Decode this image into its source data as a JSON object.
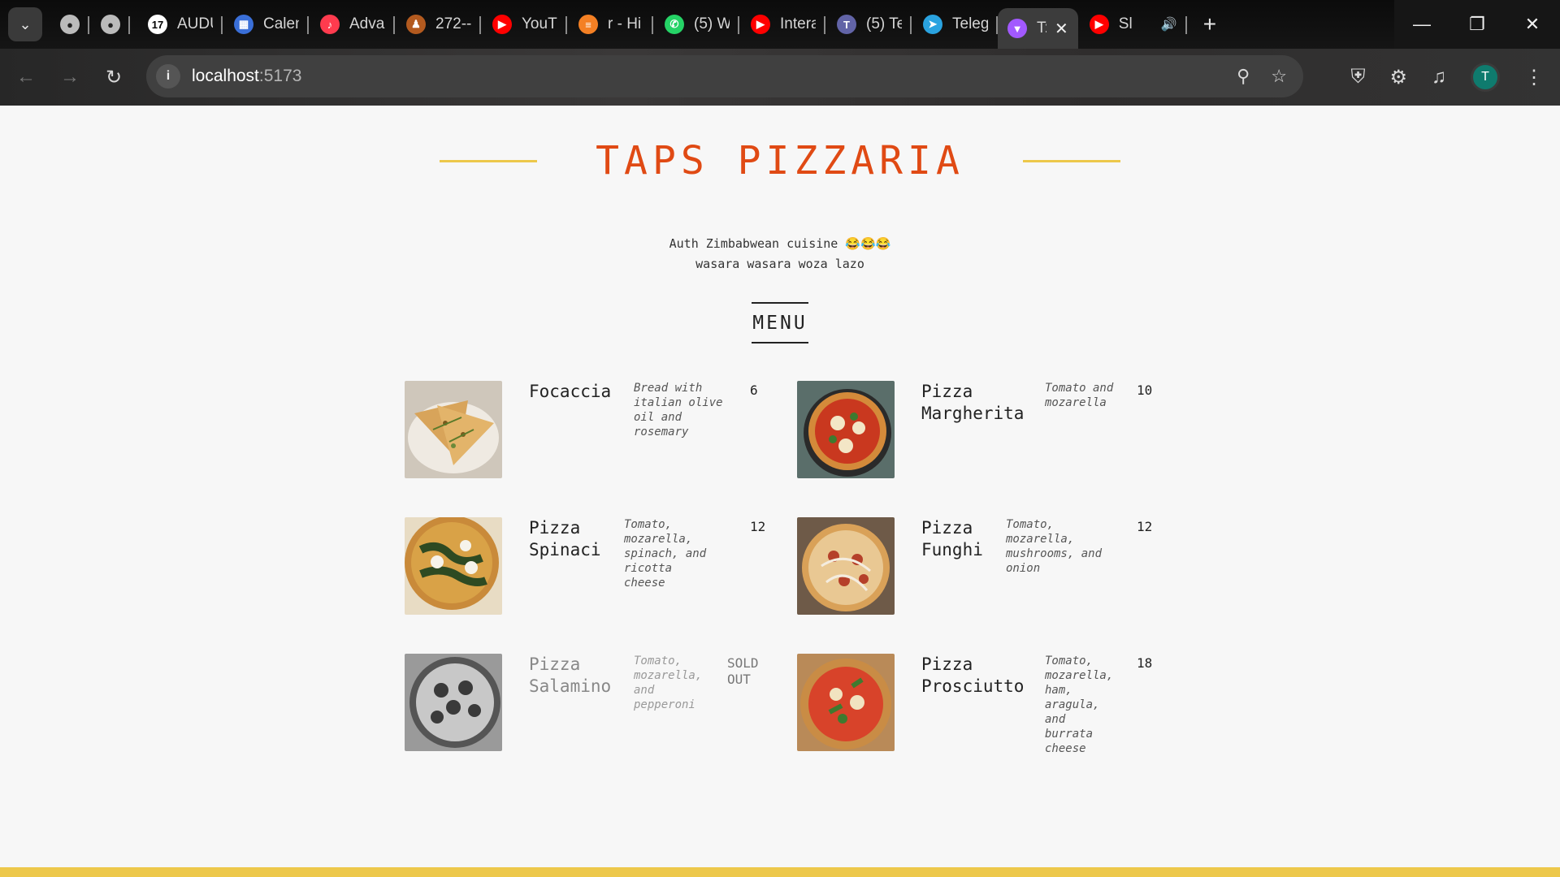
{
  "browser": {
    "tabs": [
      {
        "title": "AUDU",
        "icon": "tradingview-icon",
        "color": "#ffffff"
      },
      {
        "title": "Calen",
        "icon": "calendar-icon",
        "color": "#3a6fd8"
      },
      {
        "title": "Advar",
        "icon": "music-icon",
        "color": "#ff3b4e"
      },
      {
        "title": "272--",
        "icon": "person-icon",
        "color": "#b35a1f"
      },
      {
        "title": "YouTu",
        "icon": "youtube-icon",
        "color": "#ff0000"
      },
      {
        "title": "r - Hi",
        "icon": "stack-icon",
        "color": "#f48024"
      },
      {
        "title": "(5) W",
        "icon": "whatsapp-icon",
        "color": "#25d366"
      },
      {
        "title": "Intera",
        "icon": "youtube-icon",
        "color": "#ff0000"
      },
      {
        "title": "(5) Te",
        "icon": "teams-icon",
        "color": "#6264a7"
      },
      {
        "title": "Teleg",
        "icon": "telegram-icon",
        "color": "#2aa3e0"
      },
      {
        "title": "T:",
        "icon": "vite-icon",
        "color": "#a259ff",
        "active": true
      },
      {
        "title": "Sl",
        "icon": "youtube-icon",
        "color": "#ff0000"
      }
    ],
    "url_host": "localhost",
    "url_port": ":5173",
    "profile_initial": "T"
  },
  "page": {
    "title": "TAPS PIZZARIA",
    "tagline_line1": "Auth Zimbabwean cuisine 😂😂😂",
    "tagline_line2": "wasara wasara woza lazo",
    "menu_heading": "MENU"
  },
  "menu": [
    {
      "name": "Focaccia",
      "desc": "Bread with italian olive oil and rosemary",
      "price": "6",
      "image": "focaccia",
      "sold_out": false
    },
    {
      "name": "Pizza Margherita",
      "desc": "Tomato and mozarella",
      "price": "10",
      "image": "margherita",
      "sold_out": false
    },
    {
      "name": "Pizza Spinaci",
      "desc": "Tomato, mozarella, spinach, and ricotta cheese",
      "price": "12",
      "image": "spinaci",
      "sold_out": false
    },
    {
      "name": "Pizza Funghi",
      "desc": "Tomato, mozarella, mushrooms, and onion",
      "price": "12",
      "image": "funghi",
      "sold_out": false
    },
    {
      "name": "Pizza Salamino",
      "desc": "Tomato, mozarella, and pepperoni",
      "price": "SOLD OUT",
      "image": "salamino",
      "sold_out": true
    },
    {
      "name": "Pizza Prosciutto",
      "desc": "Tomato, mozarella, ham, aragula, and burrata cheese",
      "price": "18",
      "image": "prosciutto",
      "sold_out": false
    }
  ],
  "colors": {
    "accent": "#e04a14",
    "gold": "#edc84b"
  }
}
